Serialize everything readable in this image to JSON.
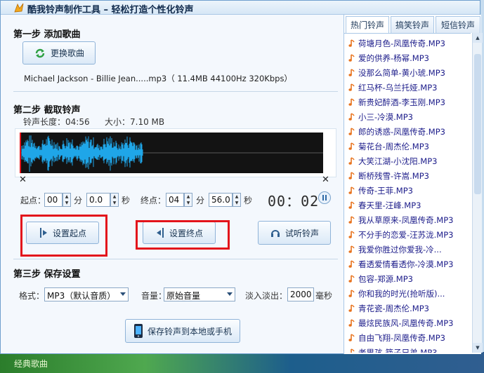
{
  "window": {
    "title": "酷我铃声制作工具 – 轻松打造个性化铃声"
  },
  "step1": {
    "title": "第一步  添加歌曲",
    "change_button": "更换歌曲",
    "file_info": "Michael Jackson - Billie Jean.....mp3（ 11.4MB 44100Hz  320Kbps）"
  },
  "step2": {
    "title": "第二步  截取铃声",
    "length_label": "铃声长度：04:56",
    "size_label": "大小：7.10 MB",
    "start_label": "起点：",
    "start_min": "00",
    "min_unit": "分",
    "start_sec": "0.0",
    "sec_unit": "秒",
    "end_label": "终点：",
    "end_min": "04",
    "end_sec": "56.0",
    "clock": "00：02",
    "set_start_button": "设置起点",
    "set_end_button": "设置终点",
    "listen_button": "试听铃声"
  },
  "step3": {
    "title": "第三步  保存设置",
    "format_label": "格式：",
    "format_value": "MP3（默认音质）",
    "volume_label": "音量：",
    "volume_value": "原始音量",
    "fade_label": "淡入淡出：",
    "fade_value": "2000",
    "fade_unit": "毫秒",
    "save_button": "保存铃声到本地或手机"
  },
  "right": {
    "tabs": [
      "热门铃声",
      "搞笑铃声",
      "短信铃声"
    ],
    "songs": [
      "荷塘月色-凤凰传奇.MP3",
      "爱的供养-杨幂.MP3",
      "没那么简单-黄小琥.MP3",
      "红马杯-乌兰托娅.MP3",
      "新贵妃醉酒-李玉刚.MP3",
      "小三-冷漠.MP3",
      "郎的诱惑-凤凰传奇.MP3",
      "菊花台-周杰伦.MP3",
      "大笑江湖-小沈阳.MP3",
      "断桥残雪-许嵩.MP3",
      "传奇-王菲.MP3",
      "春天里-汪峰.MP3",
      "我从草原来-凤凰传奇.MP3",
      "不分手的恋爱-汪苏泷.MP3",
      "我爱你胜过你爱我-冷...",
      "看透爱情看透你-冷漠.MP3",
      "包容-郑源.MP3",
      "你和我的时光(抢听版)...",
      "青花瓷-周杰伦.MP3",
      "最炫民族风-凤凰传奇.MP3",
      "自由飞翔-凤凰传奇.MP3",
      "老男孩-筷子兄弟.MP3"
    ]
  },
  "background": {
    "left_text": "经典歌曲"
  },
  "colors": {
    "accent_red": "#e3141b",
    "wave_blue": "#1fa6e8",
    "link_blue": "#1c1c8a"
  }
}
